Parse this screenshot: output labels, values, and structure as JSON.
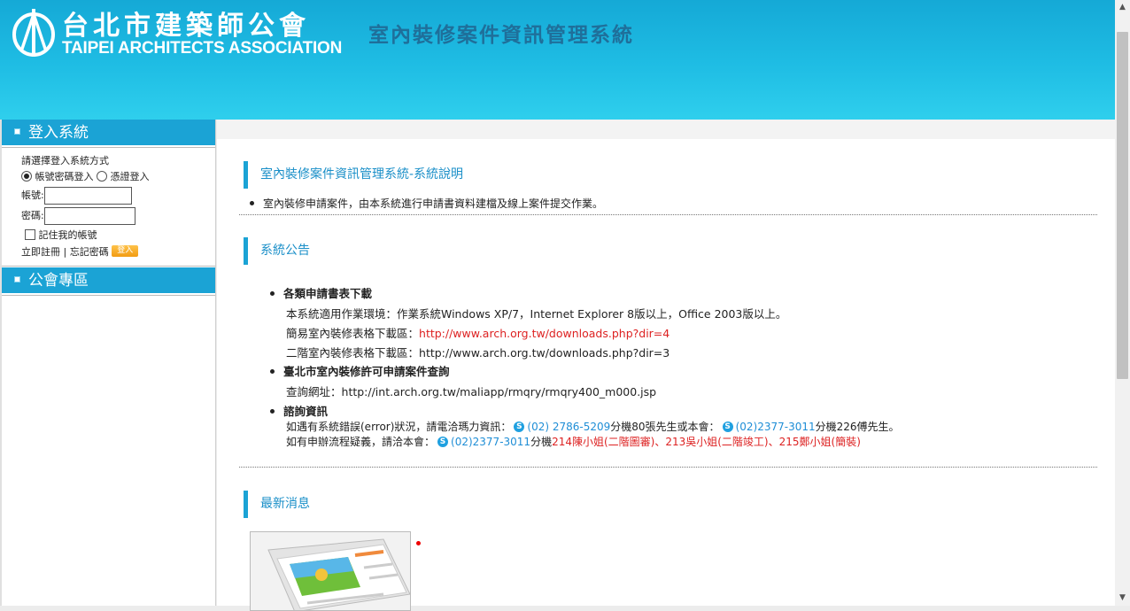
{
  "header": {
    "logo_cn": "台北市建築師公會",
    "logo_en": "TAIPEI ARCHITECTS ASSOCIATION",
    "system_title": "室內裝修案件資訊管理系統"
  },
  "sidebar": {
    "login_title": "登入系統",
    "choose_method": "請選擇登入系統方式",
    "option_password": "帳號密碼登入",
    "option_cert": "憑證登入",
    "account_label": "帳號:",
    "password_label": "密碼:",
    "remember_label": "記住我的帳號",
    "register_link": "立即註冊",
    "separator": "|",
    "forgot_link": "忘記密碼",
    "login_button": "登入",
    "association_title": "公會專區"
  },
  "main": {
    "intro_title": "室內裝修案件資訊管理系統-系統說明",
    "intro_text": "室內裝修申請案件，由本系統進行申請書資料建檔及線上案件提交作業。",
    "announce_title": "系統公告",
    "item1_title": "各類申請書表下載",
    "item1_line1": "本系統適用作業環境：作業系統Windows XP/7，Internet Explorer 8版以上，Office 2003版以上。",
    "item1_line2_label": "簡易室內裝修表格下載區：",
    "item1_line2_link": "http://www.arch.org.tw/downloads.php?dir=4",
    "item1_line3_label": "二階室內裝修表格下載區：",
    "item1_line3_link": "http://www.arch.org.tw/downloads.php?dir=3",
    "item2_title": "臺北市室內裝修許可申請案件查詢",
    "item2_line1_label": "查詢網址：",
    "item2_line1_link": "http://int.arch.org.tw/maliapp/rmqry/rmqry400_m000.jsp",
    "item3_title": "諮詢資訊",
    "item3_line1_a": "如遇有系統錯誤(error)狀況，請電洽瑪力資訊：",
    "item3_line1_phone1": "(02) 2786-5209",
    "item3_line1_b": "分機80張先生或本會：",
    "item3_line1_phone2": "(02)2377-3011",
    "item3_line1_c": "分機226傅先生。",
    "item3_line2_a": "如有申辦流程疑義，請洽本會：",
    "item3_line2_phone": "(02)2377-3011",
    "item3_line2_b": "分機",
    "item3_line2_red": "214陳小姐(二階圖審)、213吳小姐(二階竣工)、215鄭小姐(簡裝)",
    "news_title": "最新消息"
  },
  "colors": {
    "header_top": "#15a9d6",
    "header_bottom": "#2fcfed",
    "accent": "#1ba3d5",
    "link_red": "#d22222",
    "phone_blue": "#1f8ed6"
  },
  "icons": [
    "logo-emblem-icon",
    "skype-icon",
    "bullet-square-icon"
  ]
}
